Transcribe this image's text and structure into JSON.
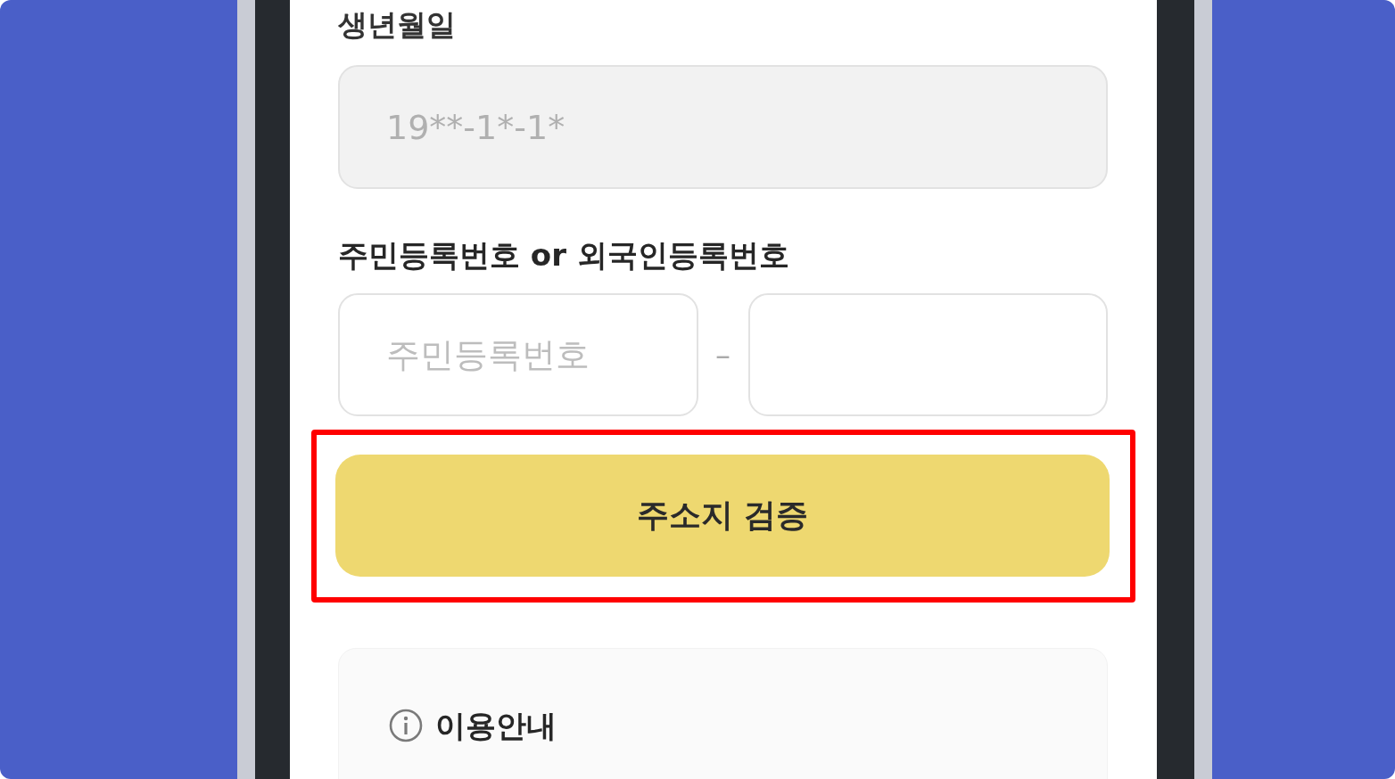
{
  "birth_date": {
    "label": "생년월일",
    "value": "19**-1*-1*",
    "disabled": true
  },
  "registration_number": {
    "label": "주민등록번호 or 외국인등록번호",
    "inputs": [
      {
        "placeholder": "주민등록번호",
        "disabled": false
      },
      {
        "disabled": false
      }
    ],
    "separator": "–"
  },
  "verify_button": {
    "label": "주소지 검증",
    "highlighted": true
  },
  "notice": {
    "title": "이용안내"
  }
}
